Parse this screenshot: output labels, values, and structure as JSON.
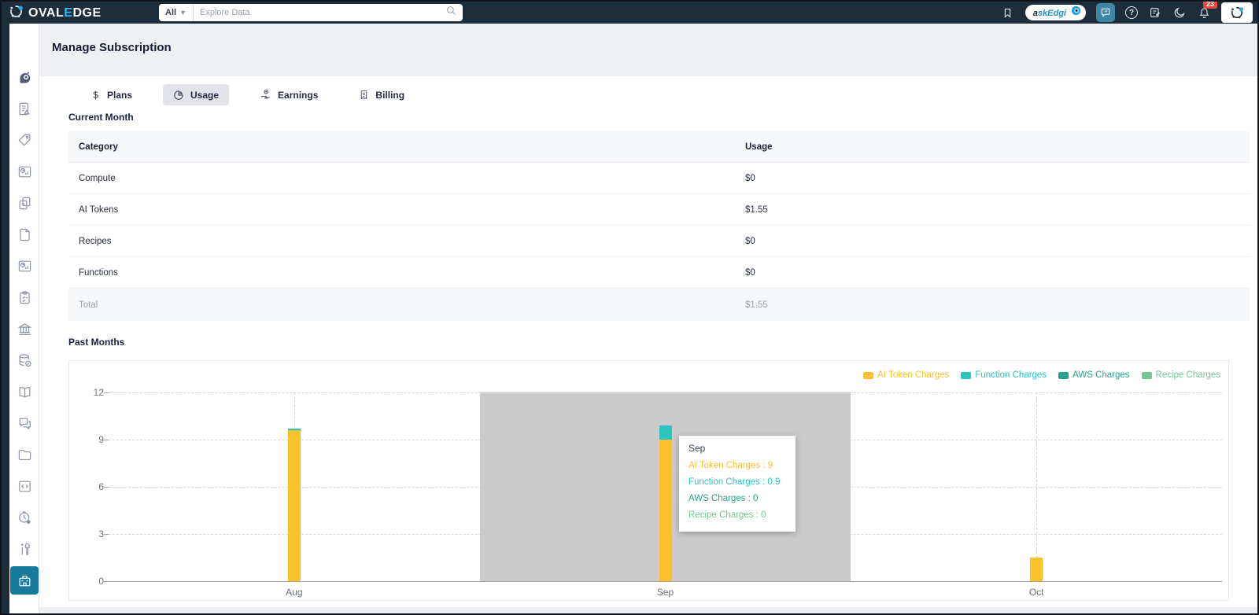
{
  "navbar": {
    "logo": {
      "part1": "OVAL",
      "accent": "E",
      "part2": "DGE"
    },
    "search": {
      "filter": "All",
      "placeholder": "Explore Data"
    },
    "askedgi_label": "askEdgi",
    "notification_count": "23"
  },
  "sidebar": {
    "items": [
      "askedgi-robot",
      "data-story",
      "tags",
      "usage-dashboard",
      "copies",
      "documents",
      "reports-dashboard",
      "checklist",
      "governance-bank",
      "data-sources",
      "business-glossary",
      "collaboration-chat",
      "projects-folder",
      "query-sheet",
      "job-scheduler",
      "admin-tools",
      "subscription-building"
    ],
    "active_item": "subscription-building"
  },
  "page": {
    "title": "Manage Subscription"
  },
  "tabs": [
    {
      "label": "Plans",
      "icon": "dollar-icon",
      "active": false
    },
    {
      "label": "Usage",
      "icon": "pie-chart-icon",
      "active": true
    },
    {
      "label": "Earnings",
      "icon": "earnings-hand-icon",
      "active": false
    },
    {
      "label": "Billing",
      "icon": "billing-receipt-icon",
      "active": false
    }
  ],
  "current_month": {
    "section_title": "Current Month",
    "table": {
      "columns": [
        "Category",
        "Usage"
      ],
      "rows": [
        [
          "Compute",
          "$0"
        ],
        [
          "AI Tokens",
          "$1.55"
        ],
        [
          "Recipes",
          "$0"
        ],
        [
          "Functions",
          "$0"
        ]
      ],
      "total": {
        "label": "Total",
        "value": "$1.55"
      }
    }
  },
  "past_months": {
    "section_title": "Past Months"
  },
  "chart_data": {
    "type": "bar",
    "stacked": true,
    "categories": [
      "Aug",
      "Sep",
      "Oct"
    ],
    "series": [
      {
        "name": "AI Token Charges",
        "color": "#fcc12d",
        "values": [
          9.6,
          9,
          1.5
        ]
      },
      {
        "name": "Function Charges",
        "color": "#2cc4bf",
        "values": [
          0.1,
          0.9,
          0
        ]
      },
      {
        "name": "AWS Charges",
        "color": "#2aa18c",
        "values": [
          0,
          0,
          0
        ]
      },
      {
        "name": "Recipe Charges",
        "color": "#74c693",
        "values": [
          0,
          0,
          0
        ]
      }
    ],
    "ylim": [
      0,
      12
    ],
    "yticks": [
      0,
      3,
      6,
      9,
      12
    ],
    "xlabel": "",
    "ylabel": "",
    "grid": true,
    "legend_position": "top-right",
    "highlighted_category": "Sep",
    "tooltip": {
      "title": "Sep",
      "lines": [
        {
          "label": "AI Token Charges",
          "value": "9"
        },
        {
          "label": "Function Charges",
          "value": "0.9"
        },
        {
          "label": "AWS Charges",
          "value": "0"
        },
        {
          "label": "Recipe Charges",
          "value": "0"
        }
      ]
    }
  },
  "colors": {
    "navbar_bg": "#1e2d3a",
    "accent_blue": "#35b6ef",
    "active_sidebar": "#17799c",
    "badge_red": "#e84840",
    "highlight_band": "#cbcbcb"
  }
}
